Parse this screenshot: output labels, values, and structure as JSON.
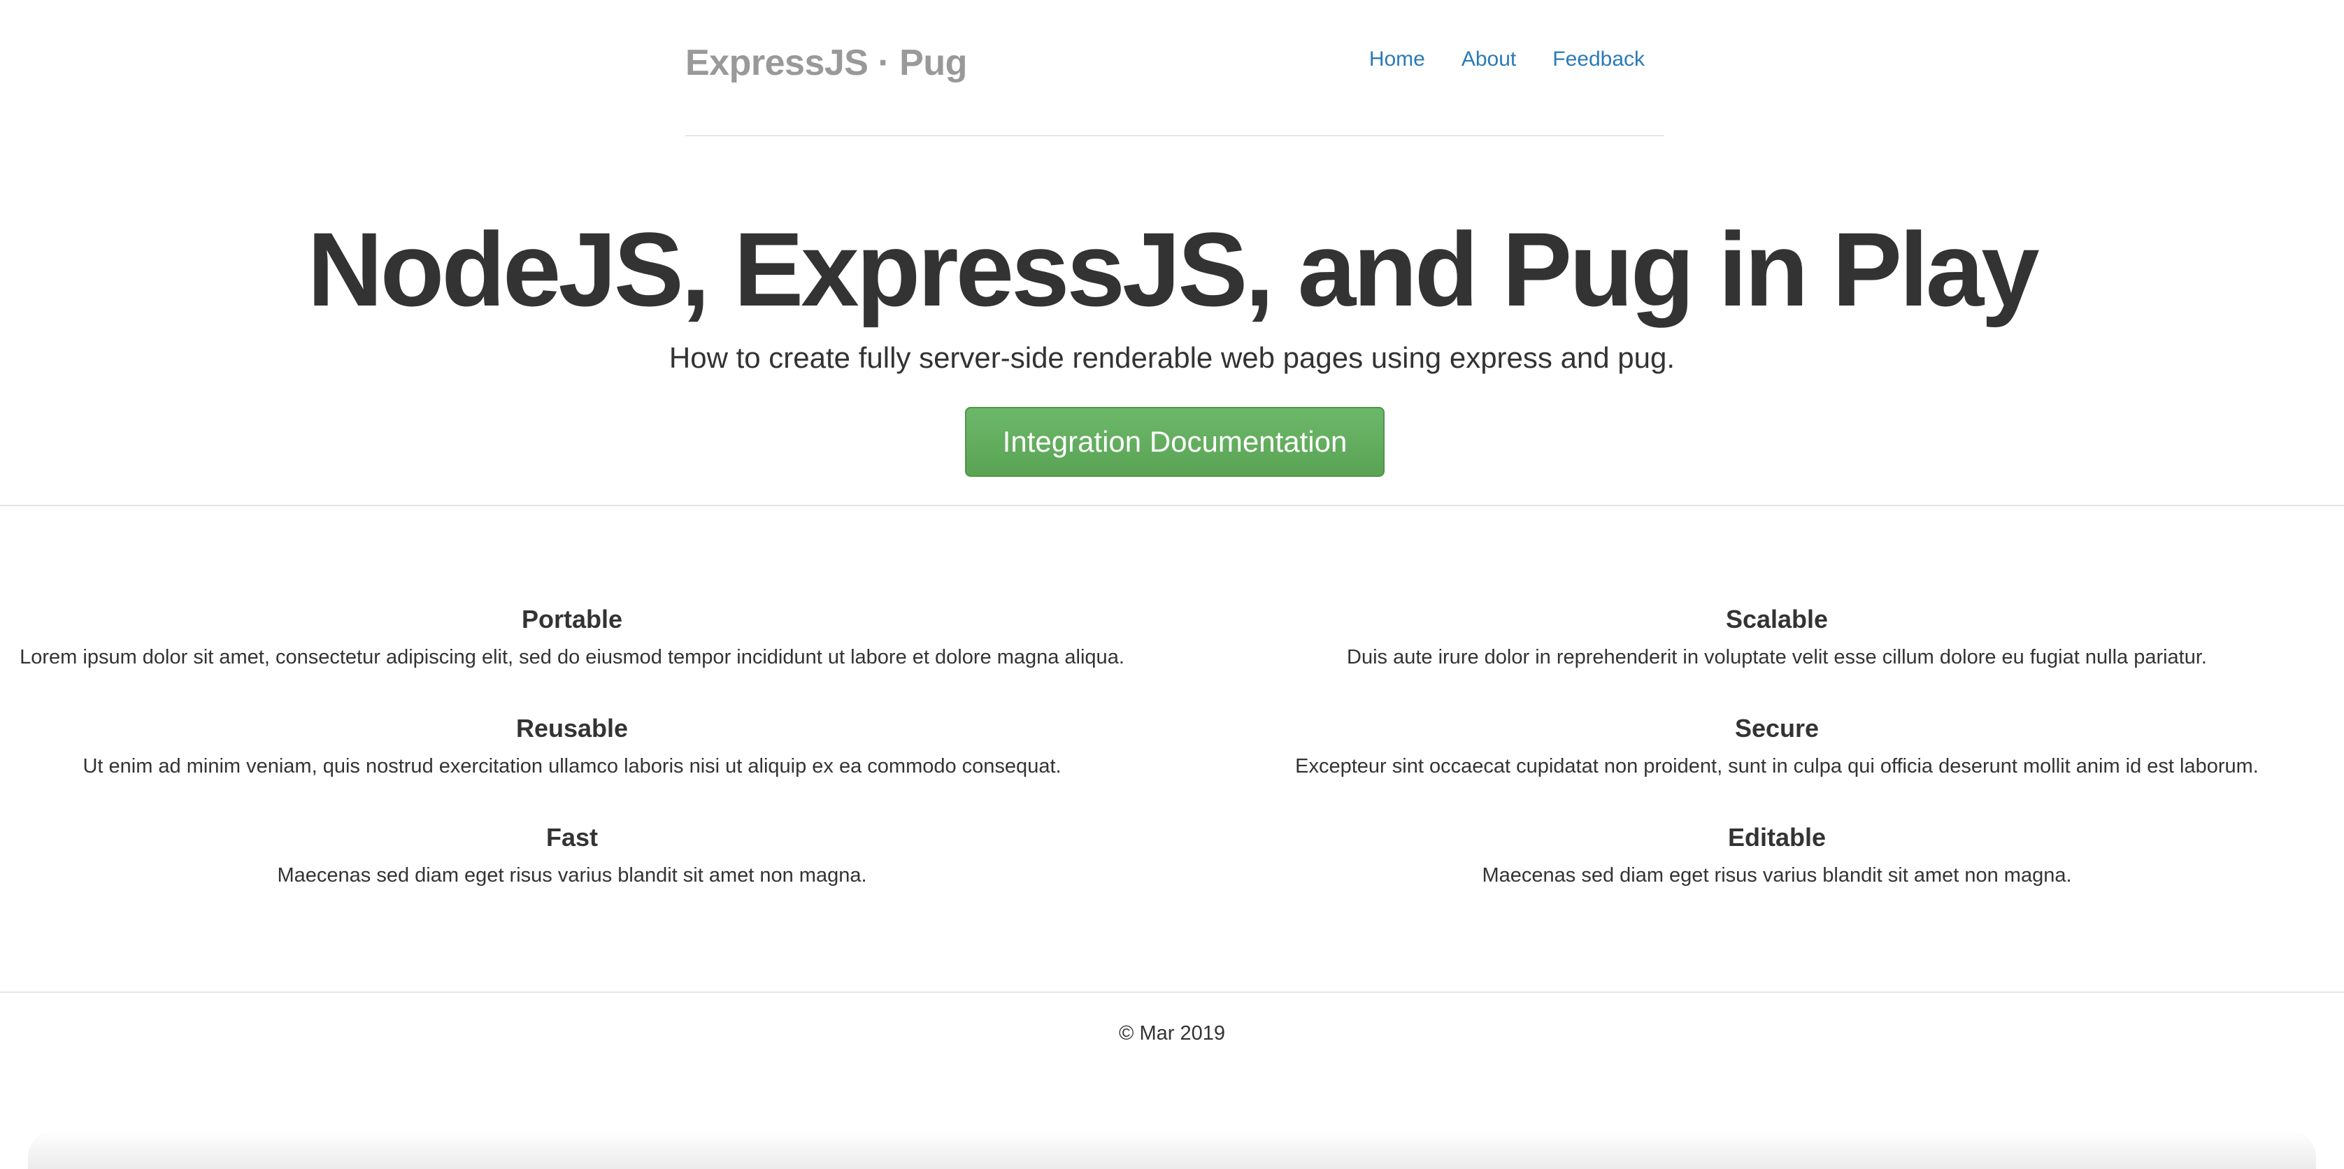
{
  "header": {
    "brand": "ExpressJS · Pug",
    "nav": [
      {
        "label": "Home"
      },
      {
        "label": "About"
      },
      {
        "label": "Feedback"
      }
    ]
  },
  "hero": {
    "title": "NodeJS, ExpressJS, and Pug in Play",
    "lead": "How to create fully server-side renderable web pages using express and pug.",
    "button_label": "Integration Documentation"
  },
  "features": {
    "left": [
      {
        "title": "Portable",
        "text": "Lorem ipsum dolor sit amet, consectetur adipiscing elit, sed do eiusmod tempor incididunt ut labore et dolore magna aliqua."
      },
      {
        "title": "Reusable",
        "text": "Ut enim ad minim veniam, quis nostrud exercitation ullamco laboris nisi ut aliquip ex ea commodo consequat."
      },
      {
        "title": "Fast",
        "text": "Maecenas sed diam eget risus varius blandit sit amet non magna."
      }
    ],
    "right": [
      {
        "title": "Scalable",
        "text": "Duis aute irure dolor in reprehenderit in voluptate velit esse cillum dolore eu fugiat nulla pariatur."
      },
      {
        "title": "Secure",
        "text": "Excepteur sint occaecat cupidatat non proident, sunt in culpa qui officia deserunt mollit anim id est laborum."
      },
      {
        "title": "Editable",
        "text": "Maecenas sed diam eget risus varius blandit sit amet non magna."
      }
    ]
  },
  "footer": {
    "text": "© Mar 2019"
  },
  "colors": {
    "link": "#2a7ab8",
    "button": "#5cb85c",
    "brand": "#999999",
    "text": "#333333"
  }
}
